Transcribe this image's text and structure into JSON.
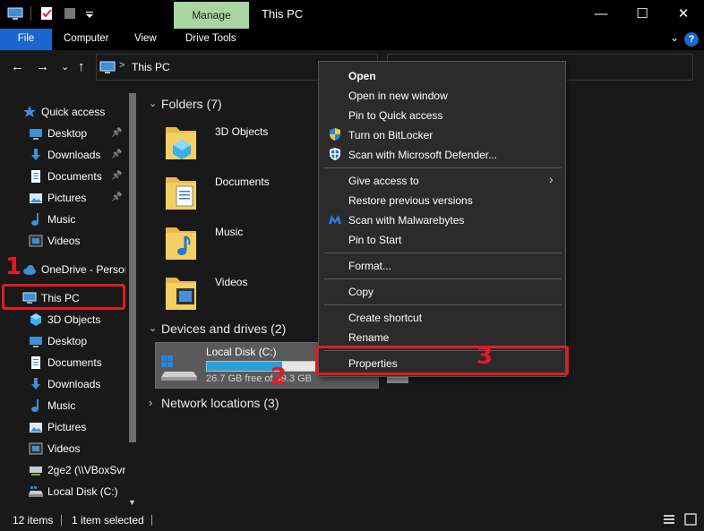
{
  "window": {
    "title": "This PC",
    "manage_tab": "Manage",
    "minimize": "—",
    "maximize": "☐",
    "close": "✕"
  },
  "ribbon": {
    "tabs": [
      "File",
      "Computer",
      "View",
      "Drive Tools"
    ],
    "help": "?",
    "collapse": "⌄"
  },
  "address": {
    "path": "This PC",
    "separator": ">"
  },
  "nav": {
    "back": "←",
    "forward": "→",
    "recent": "⌄",
    "up": "↑",
    "items": [
      {
        "label": "Quick access",
        "icon": "star-icon"
      },
      {
        "label": "Desktop",
        "icon": "desktop-icon",
        "pinned": true
      },
      {
        "label": "Downloads",
        "icon": "download-icon",
        "pinned": true
      },
      {
        "label": "Documents",
        "icon": "documents-icon",
        "pinned": true
      },
      {
        "label": "Pictures",
        "icon": "pictures-icon",
        "pinned": true
      },
      {
        "label": "Music",
        "icon": "music-icon"
      },
      {
        "label": "Videos",
        "icon": "videos-icon"
      },
      {
        "label": "OneDrive - Person",
        "icon": "cloud-icon"
      },
      {
        "label": "This PC",
        "icon": "computer-icon"
      },
      {
        "label": "3D Objects",
        "icon": "cube-icon"
      },
      {
        "label": "Desktop",
        "icon": "desktop-icon"
      },
      {
        "label": "Documents",
        "icon": "documents-icon"
      },
      {
        "label": "Downloads",
        "icon": "download-icon"
      },
      {
        "label": "Music",
        "icon": "music-icon"
      },
      {
        "label": "Pictures",
        "icon": "pictures-icon"
      },
      {
        "label": "Videos",
        "icon": "videos-icon"
      },
      {
        "label": "2ge2 (\\\\VBoxSvr",
        "icon": "network-drive-icon"
      },
      {
        "label": "Local Disk (C:)",
        "icon": "disk-icon"
      }
    ]
  },
  "main": {
    "folders_header": "Folders (7)",
    "folders": [
      "3D Objects",
      "Documents",
      "Music",
      "Videos"
    ],
    "devices_header": "Devices and drives (2)",
    "drive": {
      "name": "Local Disk (C:)",
      "free_text": "26.7 GB free of 49.3 GB",
      "used_fraction": 0.46
    },
    "network_header": "Network locations (3)"
  },
  "context_menu": {
    "items": [
      {
        "label": "Open",
        "bold": true
      },
      {
        "label": "Open in new window"
      },
      {
        "label": "Pin to Quick access"
      },
      {
        "label": "Turn on BitLocker",
        "icon": "shield-icon"
      },
      {
        "label": "Scan with Microsoft Defender...",
        "icon": "defender-icon"
      },
      {
        "label": "Give access to",
        "submenu": true
      },
      {
        "label": "Restore previous versions"
      },
      {
        "label": "Scan with Malwarebytes",
        "icon": "malwarebytes-icon"
      },
      {
        "label": "Pin to Start"
      },
      {
        "label": "Format..."
      },
      {
        "label": "Copy"
      },
      {
        "label": "Create shortcut"
      },
      {
        "label": "Rename"
      },
      {
        "label": "Properties"
      }
    ]
  },
  "annotations": {
    "step1": "1",
    "step2": "2",
    "step3": "3",
    "color": "#e21b23"
  },
  "status": {
    "items_count": "12 items",
    "selected": "1 item selected"
  },
  "colors": {
    "background": "#191919",
    "accent": "#1a66cc",
    "manage": "#a8d5a0",
    "drive_fill": "#26a0da"
  }
}
